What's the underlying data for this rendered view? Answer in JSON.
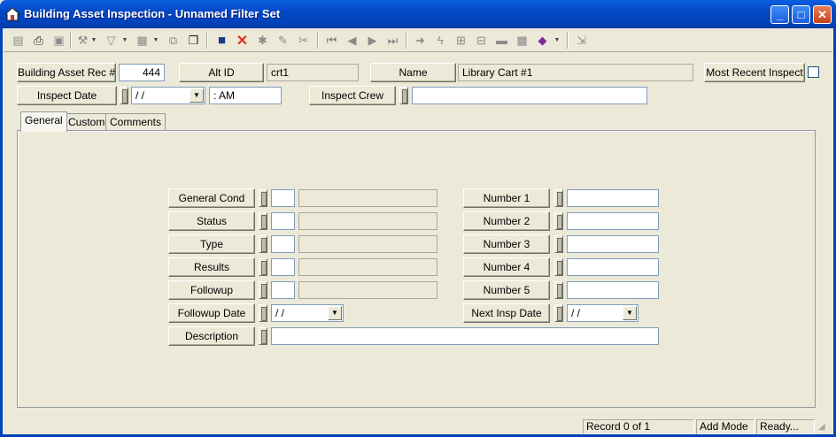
{
  "window": {
    "title": "Building Asset Inspection - Unnamed Filter Set",
    "minimize_glyph": "_",
    "maximize_glyph": "□",
    "close_glyph": "✕"
  },
  "header": {
    "rec_label": "Building Asset Rec #",
    "rec_value": "444",
    "altid_label": "Alt ID",
    "altid_value": "crt1",
    "name_label": "Name",
    "name_value": "Library Cart #1",
    "most_recent_label": "Most Recent Inspect",
    "inspect_date_label": "Inspect Date",
    "inspect_date_value": " / /",
    "inspect_time_value": " :  AM",
    "inspect_crew_label": "Inspect Crew",
    "inspect_crew_value": ""
  },
  "tabs": [
    {
      "label": "General"
    },
    {
      "label": "Custom"
    },
    {
      "label": "Comments"
    }
  ],
  "general": {
    "left_labels": [
      "General Cond",
      "Status",
      "Type",
      "Results",
      "Followup"
    ],
    "followup_date_label": "Followup Date",
    "followup_date_value": " / /",
    "description_label": "Description",
    "right_labels": [
      "Number 1",
      "Number 2",
      "Number 3",
      "Number 4",
      "Number 5"
    ],
    "next_insp_label": "Next Insp Date",
    "next_insp_value": " / /"
  },
  "status_bar": {
    "record": "Record 0 of 1",
    "mode": "Add Mode",
    "state": "Ready..."
  },
  "colors": {
    "titlebar": "#0348c6",
    "face": "#ece9d8",
    "close_red": "#d8341a",
    "save_blue": "#1a3a8c"
  }
}
